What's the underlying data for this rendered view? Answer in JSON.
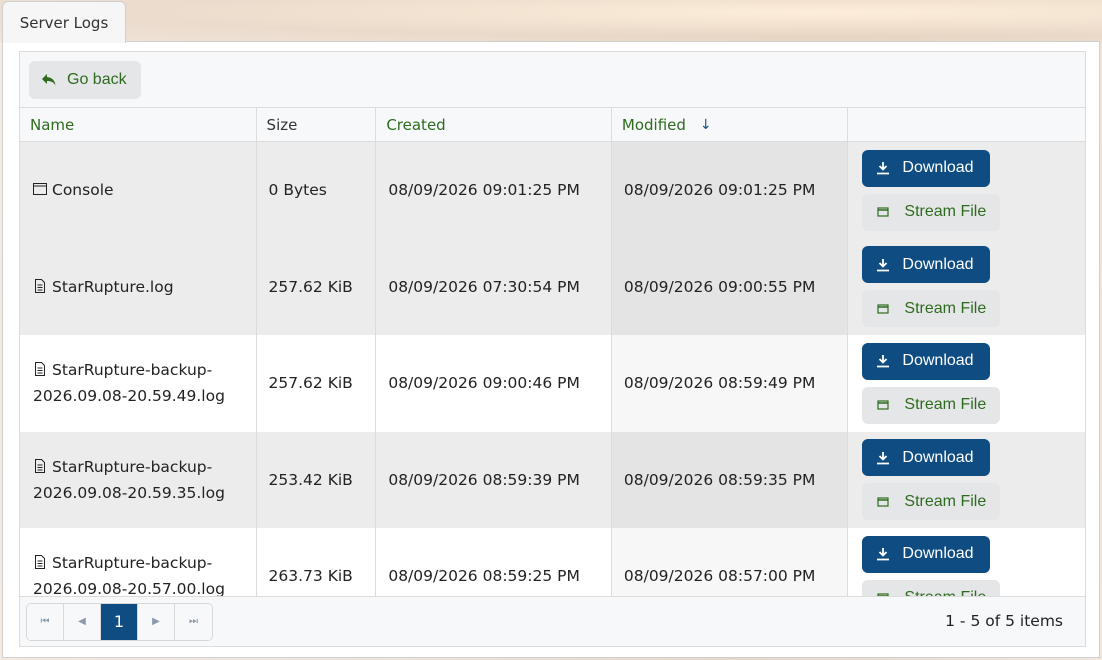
{
  "tab": {
    "label": "Server Logs"
  },
  "toolbar": {
    "back_label": "Go back"
  },
  "columns": {
    "name": "Name",
    "size": "Size",
    "created": "Created",
    "modified": "Modified"
  },
  "actions": {
    "download": "Download",
    "stream": "Stream File"
  },
  "rows": [
    {
      "icon": "console-icon",
      "name1": "Console",
      "name2": "",
      "size": "0 Bytes",
      "created": "08/09/2026 09:01:25 PM",
      "modified": "08/09/2026 09:01:25 PM"
    },
    {
      "icon": "file-icon",
      "name1": "StarRupture.log",
      "name2": "",
      "size": "257.62 KiB",
      "created": "08/09/2026 07:30:54 PM",
      "modified": "08/09/2026 09:00:55 PM"
    },
    {
      "icon": "file-icon",
      "name1": "StarRupture-backup-",
      "name2": "2026.09.08-20.59.49.log",
      "size": "257.62 KiB",
      "created": "08/09/2026 09:00:46 PM",
      "modified": "08/09/2026 08:59:49 PM"
    },
    {
      "icon": "file-icon",
      "name1": "StarRupture-backup-",
      "name2": "2026.09.08-20.59.35.log",
      "size": "253.42 KiB",
      "created": "08/09/2026 08:59:39 PM",
      "modified": "08/09/2026 08:59:35 PM"
    },
    {
      "icon": "file-icon",
      "name1": "StarRupture-backup-",
      "name2": "2026.09.08-20.57.00.log",
      "size": "263.73 KiB",
      "created": "08/09/2026 08:59:25 PM",
      "modified": "08/09/2026 08:57:00 PM"
    }
  ],
  "pager": {
    "current_page": "1",
    "info": "1 - 5 of 5 items"
  },
  "colors": {
    "accent": "#0f4c81",
    "link": "#2e6b1f"
  }
}
